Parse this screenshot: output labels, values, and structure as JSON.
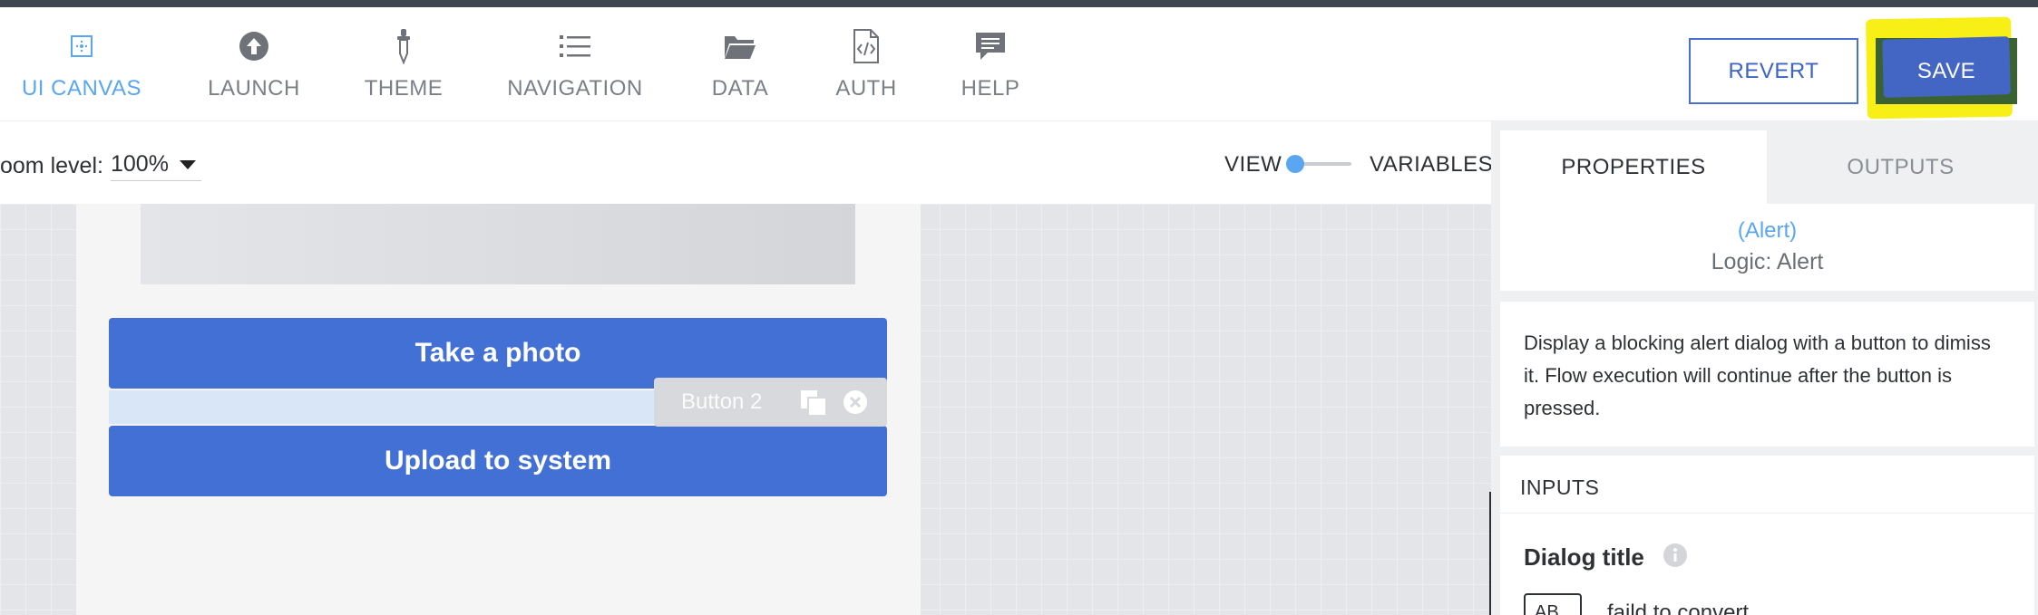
{
  "nav": {
    "items": [
      {
        "label": "UI CANVAS",
        "icon": "ui-canvas-icon",
        "active": true
      },
      {
        "label": "LAUNCH",
        "icon": "launch-icon"
      },
      {
        "label": "THEME",
        "icon": "eyedropper-icon"
      },
      {
        "label": "NAVIGATION",
        "icon": "list-icon"
      },
      {
        "label": "DATA",
        "icon": "folder-icon"
      },
      {
        "label": "AUTH",
        "icon": "code-file-icon"
      },
      {
        "label": "HELP",
        "icon": "chat-bubble-icon"
      }
    ],
    "revert_label": "REVERT",
    "save_label": "SAVE"
  },
  "subbar": {
    "zoom_label": "oom level:",
    "zoom_value": "100%",
    "view_label": "VIEW",
    "variables_label": "VARIABLES"
  },
  "canvas": {
    "take_photo_label": "Take a photo",
    "upload_label": "Upload to system",
    "selected_tag": "Button 2"
  },
  "panel": {
    "tabs": {
      "properties": "PROPERTIES",
      "outputs": "OUTPUTS"
    },
    "component_name": "(Alert)",
    "component_type": "Logic: Alert",
    "description": "Display a blocking alert dialog with a button to dimiss it. Flow execution will continue after the button is pressed.",
    "inputs_header": "INPUTS",
    "dialog_title_label": "Dialog title",
    "text_type_badge": "AB",
    "dialog_title_value": "faild to convert"
  },
  "colors": {
    "accent": "#5aa6f0",
    "primary_button": "#4370d4",
    "highlight": "#f8ef16"
  }
}
